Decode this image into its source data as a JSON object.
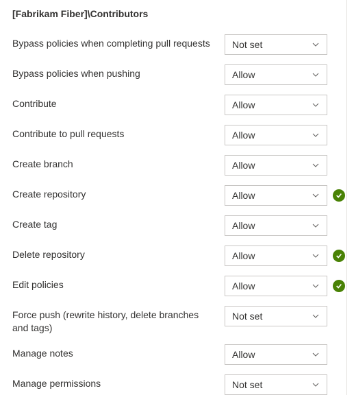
{
  "header": "[Fabrikam Fiber]\\Contributors",
  "permissions": [
    {
      "label": "Bypass policies when completing pull requests",
      "value": "Not set",
      "inherited": false
    },
    {
      "label": "Bypass policies when pushing",
      "value": "Allow",
      "inherited": false
    },
    {
      "label": "Contribute",
      "value": "Allow",
      "inherited": false
    },
    {
      "label": "Contribute to pull requests",
      "value": "Allow",
      "inherited": false
    },
    {
      "label": "Create branch",
      "value": "Allow",
      "inherited": false
    },
    {
      "label": "Create repository",
      "value": "Allow",
      "inherited": true
    },
    {
      "label": "Create tag",
      "value": "Allow",
      "inherited": false
    },
    {
      "label": "Delete repository",
      "value": "Allow",
      "inherited": true
    },
    {
      "label": "Edit policies",
      "value": "Allow",
      "inherited": true
    },
    {
      "label": "Force push (rewrite history, delete branches and tags)",
      "value": "Not set",
      "inherited": false
    },
    {
      "label": "Manage notes",
      "value": "Allow",
      "inherited": false
    },
    {
      "label": "Manage permissions",
      "value": "Not set",
      "inherited": false
    }
  ]
}
